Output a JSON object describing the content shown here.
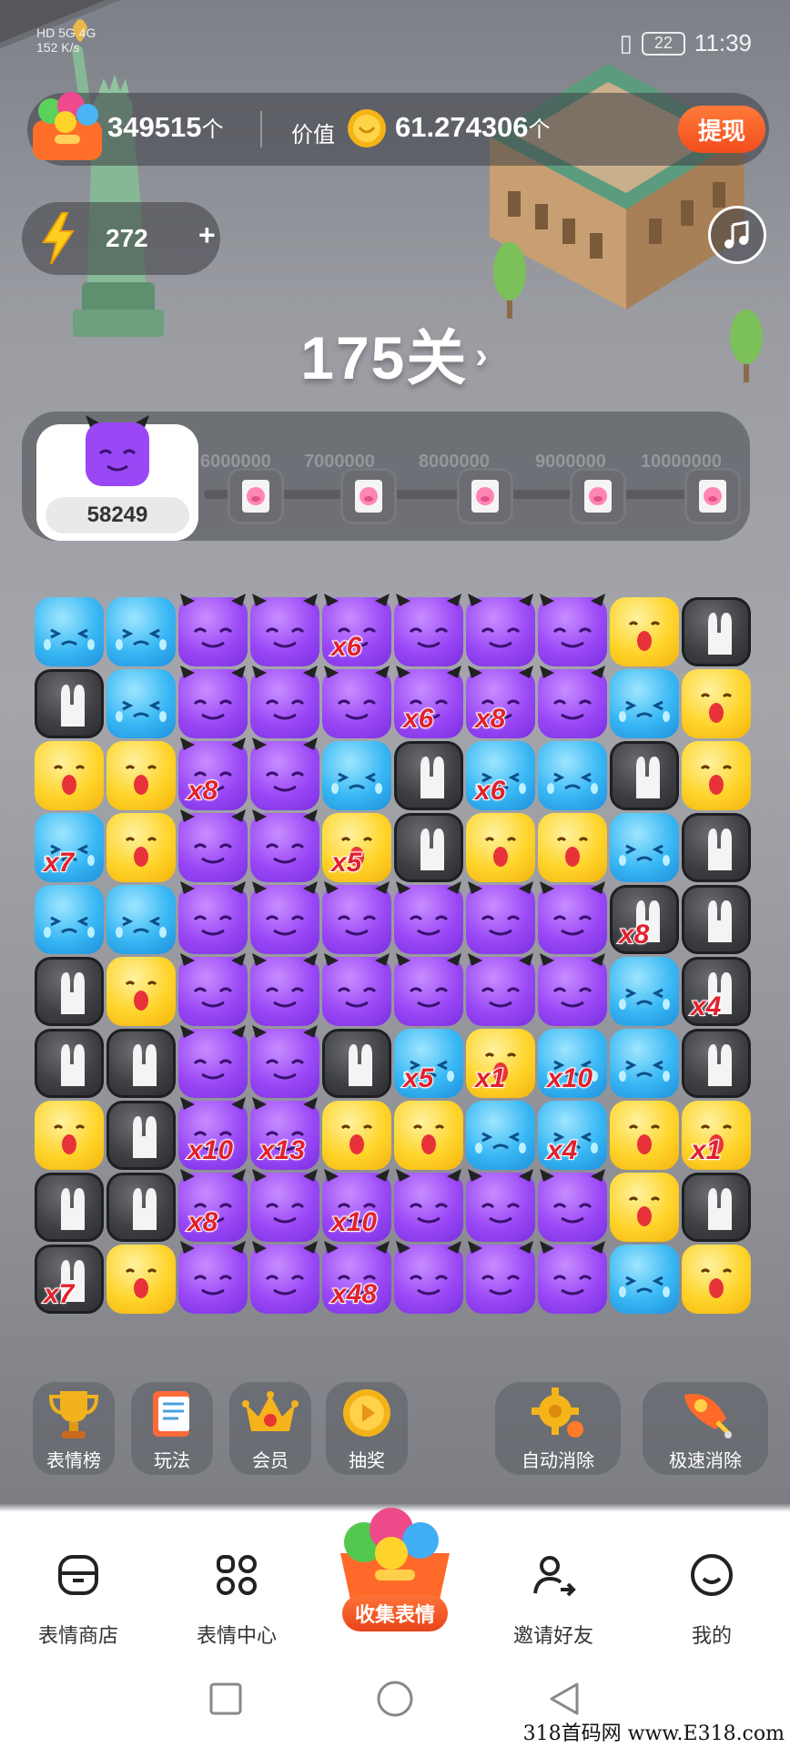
{
  "status_bar": {
    "network_left": "HD 5G 4G",
    "speed": "152 K/s",
    "battery": "22",
    "time": "11:39"
  },
  "header": {
    "emoji_count": "349515",
    "emoji_count_unit": "个",
    "value_label": "价值",
    "value_amount": "61.274306",
    "value_unit": "个",
    "withdraw_label": "提现"
  },
  "energy": {
    "value": "272",
    "plus": "+"
  },
  "level": {
    "label": "175关",
    "arrow": "›"
  },
  "progress": {
    "score": "58249",
    "milestones": [
      "6000000",
      "7000000",
      "8000000",
      "9000000",
      "10000000"
    ]
  },
  "board": {
    "rows": [
      [
        "blue",
        "blue",
        "purple",
        "purple",
        "purple",
        "purple",
        "purple",
        "purple",
        "yellow",
        "rabbit"
      ],
      [
        "rabbit",
        "blue",
        "purple",
        "purple",
        "purple",
        "purple",
        "purple",
        "purple",
        "blue",
        "yellow"
      ],
      [
        "yellow",
        "yellow",
        "purple",
        "purple",
        "blue",
        "rabbit",
        "blue",
        "blue",
        "rabbit",
        "yellow"
      ],
      [
        "blue",
        "yellow",
        "purple",
        "purple",
        "yellow",
        "rabbit",
        "yellow",
        "yellow",
        "blue",
        "rabbit"
      ],
      [
        "blue",
        "blue",
        "purple",
        "purple",
        "purple",
        "purple",
        "purple",
        "purple",
        "rabbit",
        "rabbit"
      ],
      [
        "rabbit",
        "yellow",
        "purple",
        "purple",
        "purple",
        "purple",
        "purple",
        "purple",
        "blue",
        "rabbit"
      ],
      [
        "rabbit",
        "rabbit",
        "purple",
        "purple",
        "rabbit",
        "blue",
        "yellow",
        "blue",
        "blue",
        "rabbit"
      ],
      [
        "yellow",
        "rabbit",
        "purple",
        "purple",
        "yellow",
        "yellow",
        "blue",
        "blue",
        "yellow",
        "yellow"
      ],
      [
        "rabbit",
        "rabbit",
        "purple",
        "purple",
        "purple",
        "purple",
        "purple",
        "purple",
        "yellow",
        "rabbit"
      ],
      [
        "rabbit",
        "yellow",
        "purple",
        "purple",
        "purple",
        "purple",
        "purple",
        "purple",
        "blue",
        "yellow"
      ]
    ],
    "multipliers": [
      {
        "row": 0,
        "col": 4,
        "text": "x6"
      },
      {
        "row": 1,
        "col": 5,
        "text": "x6"
      },
      {
        "row": 1,
        "col": 6,
        "text": "x8"
      },
      {
        "row": 2,
        "col": 2,
        "text": "x8"
      },
      {
        "row": 2,
        "col": 6,
        "text": "x6"
      },
      {
        "row": 3,
        "col": 0,
        "text": "x7"
      },
      {
        "row": 3,
        "col": 4,
        "text": "x5"
      },
      {
        "row": 4,
        "col": 8,
        "text": "x8"
      },
      {
        "row": 5,
        "col": 9,
        "text": "x4"
      },
      {
        "row": 6,
        "col": 5,
        "text": "x5"
      },
      {
        "row": 6,
        "col": 6,
        "text": "x1"
      },
      {
        "row": 6,
        "col": 7,
        "text": "x10"
      },
      {
        "row": 7,
        "col": 2,
        "text": "x10"
      },
      {
        "row": 7,
        "col": 3,
        "text": "x13"
      },
      {
        "row": 7,
        "col": 7,
        "text": "x4"
      },
      {
        "row": 7,
        "col": 9,
        "text": "x1"
      },
      {
        "row": 8,
        "col": 2,
        "text": "x8"
      },
      {
        "row": 8,
        "col": 4,
        "text": "x10"
      },
      {
        "row": 9,
        "col": 0,
        "text": "x7"
      },
      {
        "row": 9,
        "col": 4,
        "text": "x48"
      }
    ]
  },
  "tools": [
    {
      "label": "表情榜",
      "icon": "trophy-icon"
    },
    {
      "label": "玩法",
      "icon": "rules-book-icon"
    },
    {
      "label": "会员",
      "icon": "crown-icon"
    },
    {
      "label": "抽奖",
      "icon": "lottery-coin-icon"
    },
    {
      "label": "自动消除",
      "icon": "gear-icon"
    },
    {
      "label": "极速消除",
      "icon": "rocket-icon"
    }
  ],
  "nav": {
    "store": "表情商店",
    "center": "表情中心",
    "collect": "收集表情",
    "invite": "邀请好友",
    "mine": "我的"
  },
  "watermark": "318首码网 www.E318.com",
  "colors": {
    "accent_orange": "#f24d1c",
    "tile_blue": "#38b7f4",
    "tile_purple": "#9a48f6",
    "tile_yellow": "#ffd42a",
    "tile_rabbit": "#3c3e42",
    "multiplier_red": "#e0222e"
  }
}
